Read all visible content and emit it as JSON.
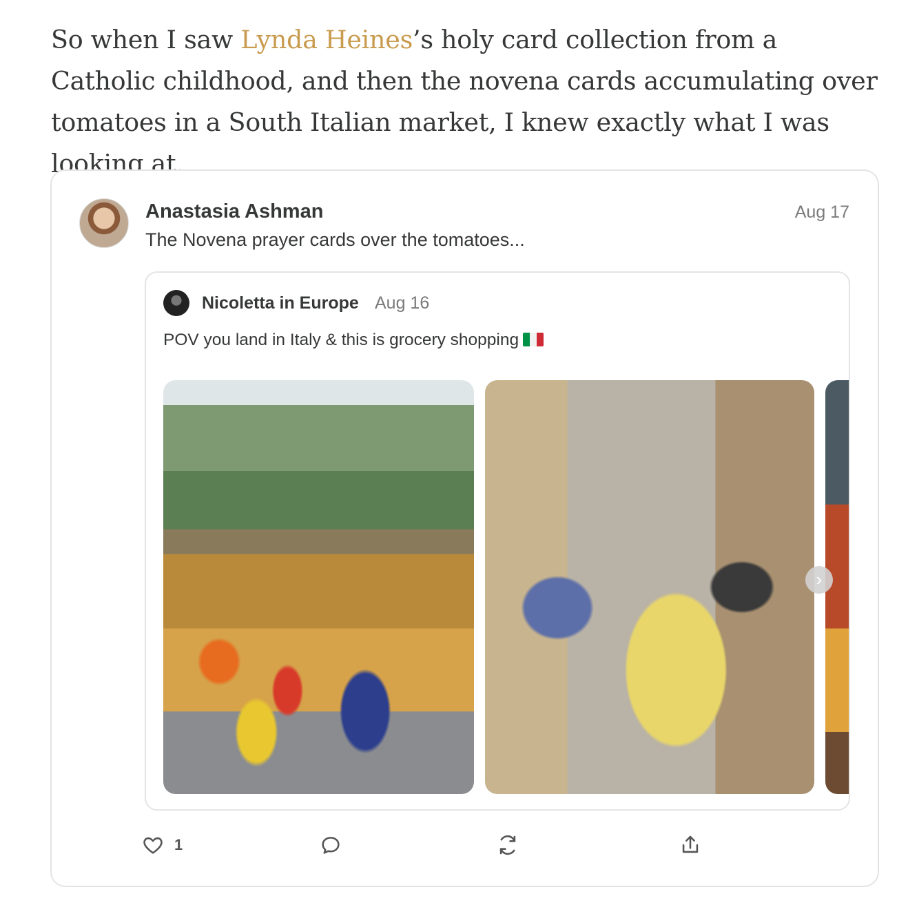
{
  "paragraph": {
    "before": "So when I saw ",
    "link": "Lynda Heines",
    "after": "’s holy card collection from a Catholic childhood, and then the novena cards accumulating over tomatoes in a South Italian market, I knew exactly what I was looking at."
  },
  "note": {
    "author": "Anastasia Ashman",
    "date": "Aug 17",
    "text": "The Novena prayer cards over the tomatoes..."
  },
  "quoted": {
    "author": "Nicoletta in Europe",
    "date": "Aug 16",
    "text": "POV you land in Italy & this is grocery shopping"
  },
  "actions": {
    "like_count": "1"
  },
  "colors": {
    "link": "#c99b4f",
    "text": "#363737",
    "muted": "#7a7a7a",
    "border": "#e4e4e4"
  }
}
